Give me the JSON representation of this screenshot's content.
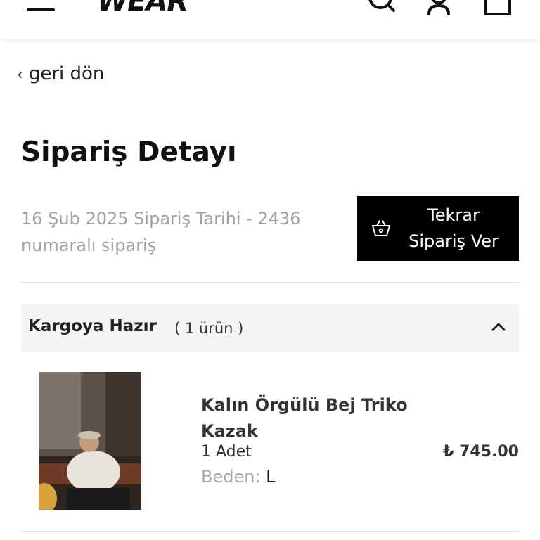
{
  "header": {
    "logo_text": "WEAR",
    "menu_icon": "hamburger-menu-icon",
    "icons": [
      "search-icon",
      "user-icon",
      "cart-icon"
    ]
  },
  "nav": {
    "back_label": "geri dön"
  },
  "page": {
    "title": "Sipariş Detayı",
    "meta_line1": "16 Şub 2025 Sipariş Tarihi - 2436",
    "meta_line2": "numaralı sipariş",
    "reorder_line1": "Tekrar",
    "reorder_line2": "Sipariş Ver"
  },
  "shipment": {
    "status": "Kargoya Hazır",
    "count": "( 1 ürün )",
    "expanded": true,
    "items": [
      {
        "name_line1": "Kalın Örgülü Bej Triko",
        "name_line2": "Kazak",
        "quantity": "1 Adet",
        "size_label": "Beden:",
        "size_value": "L",
        "price": "₺ 745.00"
      }
    ]
  },
  "colors": {
    "button_bg": "#000000",
    "status_bg": "#f4f4f6",
    "muted_text": "#a0a0a0"
  }
}
